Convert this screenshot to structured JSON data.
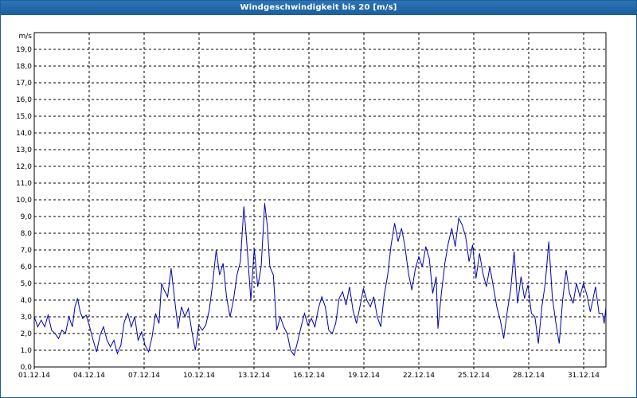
{
  "window": {
    "title": "Windgeschwindigkeit bis 20 [m/s]"
  },
  "chart_data": {
    "type": "line",
    "title": "Windgeschwindigkeit bis 20 [m/s]",
    "ylabel": "m/s",
    "ylim": [
      0,
      20
    ],
    "yticks": [
      "0,0",
      "1,0",
      "2,0",
      "3,0",
      "4,0",
      "5,0",
      "6,0",
      "7,0",
      "8,0",
      "9,0",
      "10,0",
      "11,0",
      "12,0",
      "13,0",
      "14,0",
      "15,0",
      "16,0",
      "17,0",
      "18,0",
      "19,0"
    ],
    "xlim_days": [
      1,
      32.4
    ],
    "xticks": [
      {
        "day": 1,
        "label": "01.12.14"
      },
      {
        "day": 4,
        "label": "04.12.14"
      },
      {
        "day": 7,
        "label": "07.12.14"
      },
      {
        "day": 10,
        "label": "10.12.14"
      },
      {
        "day": 13,
        "label": "13.12.14"
      },
      {
        "day": 16,
        "label": "16.12.14"
      },
      {
        "day": 19,
        "label": "19.12.14"
      },
      {
        "day": 22,
        "label": "22.12.14"
      },
      {
        "day": 25,
        "label": "25.12.14"
      },
      {
        "day": 28,
        "label": "28.12.14"
      },
      {
        "day": 31,
        "label": "31.12.14"
      }
    ],
    "grid": true,
    "line_color": "#0000b0",
    "series": [
      {
        "points": [
          [
            1.0,
            3.0
          ],
          [
            1.2,
            2.4
          ],
          [
            1.4,
            2.8
          ],
          [
            1.6,
            2.4
          ],
          [
            1.8,
            3.1
          ],
          [
            2.0,
            2.2
          ],
          [
            2.2,
            2.0
          ],
          [
            2.4,
            1.7
          ],
          [
            2.6,
            2.2
          ],
          [
            2.8,
            2.0
          ],
          [
            3.0,
            3.0
          ],
          [
            3.2,
            2.4
          ],
          [
            3.35,
            3.6
          ],
          [
            3.5,
            4.1
          ],
          [
            3.65,
            3.3
          ],
          [
            3.8,
            2.9
          ],
          [
            4.0,
            3.1
          ],
          [
            4.2,
            2.4
          ],
          [
            4.4,
            1.6
          ],
          [
            4.6,
            0.9
          ],
          [
            4.8,
            1.9
          ],
          [
            5.0,
            2.4
          ],
          [
            5.2,
            1.6
          ],
          [
            5.4,
            1.2
          ],
          [
            5.6,
            1.6
          ],
          [
            5.8,
            0.8
          ],
          [
            6.0,
            1.3
          ],
          [
            6.2,
            2.7
          ],
          [
            6.4,
            3.2
          ],
          [
            6.6,
            2.4
          ],
          [
            6.8,
            3.0
          ],
          [
            7.0,
            1.6
          ],
          [
            7.2,
            2.1
          ],
          [
            7.4,
            1.3
          ],
          [
            7.6,
            0.9
          ],
          [
            7.8,
            1.8
          ],
          [
            8.0,
            3.2
          ],
          [
            8.2,
            2.6
          ],
          [
            8.35,
            5.0
          ],
          [
            8.5,
            4.6
          ],
          [
            8.7,
            4.2
          ],
          [
            8.9,
            5.9
          ],
          [
            9.1,
            4.1
          ],
          [
            9.3,
            2.3
          ],
          [
            9.5,
            3.6
          ],
          [
            9.7,
            3.0
          ],
          [
            9.9,
            3.5
          ],
          [
            10.1,
            2.1
          ],
          [
            10.3,
            1.0
          ],
          [
            10.5,
            2.5
          ],
          [
            10.7,
            2.2
          ],
          [
            10.9,
            2.5
          ],
          [
            11.1,
            3.4
          ],
          [
            11.3,
            5.0
          ],
          [
            11.5,
            7.0
          ],
          [
            11.7,
            5.5
          ],
          [
            11.9,
            6.2
          ],
          [
            12.1,
            4.2
          ],
          [
            12.3,
            3.0
          ],
          [
            12.5,
            4.0
          ],
          [
            12.7,
            5.5
          ],
          [
            12.9,
            6.3
          ],
          [
            13.1,
            9.6
          ],
          [
            13.3,
            7.0
          ],
          [
            13.5,
            4.0
          ],
          [
            13.7,
            7.1
          ],
          [
            13.9,
            4.8
          ],
          [
            14.1,
            6.0
          ],
          [
            14.3,
            9.8
          ],
          [
            14.45,
            8.5
          ],
          [
            14.6,
            6.0
          ],
          [
            14.8,
            5.5
          ],
          [
            15.0,
            2.2
          ],
          [
            15.2,
            3.0
          ],
          [
            15.4,
            2.4
          ],
          [
            15.6,
            2.0
          ],
          [
            15.8,
            1.0
          ],
          [
            16.0,
            0.7
          ],
          [
            16.2,
            1.5
          ],
          [
            16.4,
            2.4
          ],
          [
            16.6,
            3.2
          ],
          [
            16.8,
            2.5
          ],
          [
            17.0,
            2.9
          ],
          [
            17.2,
            2.4
          ],
          [
            17.4,
            3.5
          ],
          [
            17.6,
            4.2
          ],
          [
            17.8,
            3.6
          ],
          [
            18.0,
            2.2
          ],
          [
            18.2,
            2.0
          ],
          [
            18.4,
            2.6
          ],
          [
            18.6,
            4.1
          ],
          [
            18.8,
            4.5
          ],
          [
            19.0,
            3.7
          ],
          [
            19.2,
            4.8
          ],
          [
            19.4,
            3.4
          ],
          [
            19.6,
            2.6
          ],
          [
            19.8,
            3.6
          ],
          [
            20.0,
            4.7
          ],
          [
            20.2,
            4.0
          ],
          [
            20.4,
            3.6
          ],
          [
            20.6,
            4.2
          ],
          [
            20.8,
            3.0
          ],
          [
            21.0,
            2.4
          ],
          [
            21.2,
            4.3
          ],
          [
            21.4,
            5.5
          ],
          [
            21.6,
            7.3
          ],
          [
            21.8,
            8.6
          ],
          [
            22.0,
            7.5
          ],
          [
            22.2,
            8.3
          ],
          [
            22.4,
            7.2
          ],
          [
            22.6,
            5.6
          ],
          [
            22.8,
            4.6
          ],
          [
            23.0,
            5.9
          ],
          [
            23.2,
            6.6
          ],
          [
            23.4,
            6.0
          ],
          [
            23.6,
            7.2
          ],
          [
            23.8,
            6.5
          ],
          [
            24.0,
            4.4
          ],
          [
            24.2,
            5.4
          ],
          [
            24.3,
            2.3
          ],
          [
            24.5,
            4.4
          ],
          [
            24.7,
            6.2
          ],
          [
            24.9,
            7.4
          ],
          [
            25.1,
            8.3
          ],
          [
            25.3,
            7.2
          ],
          [
            25.5,
            8.9
          ],
          [
            25.7,
            8.5
          ],
          [
            25.9,
            7.8
          ],
          [
            26.1,
            6.3
          ],
          [
            26.3,
            7.3
          ],
          [
            26.5,
            5.3
          ],
          [
            26.7,
            6.8
          ],
          [
            26.9,
            5.6
          ],
          [
            27.1,
            4.8
          ],
          [
            27.3,
            6.0
          ],
          [
            27.5,
            4.8
          ],
          [
            27.7,
            3.6
          ],
          [
            27.9,
            2.8
          ],
          [
            28.1,
            1.7
          ],
          [
            28.3,
            3.3
          ],
          [
            28.5,
            4.6
          ],
          [
            28.7,
            6.9
          ],
          [
            28.9,
            3.8
          ],
          [
            29.1,
            5.4
          ],
          [
            29.3,
            4.1
          ],
          [
            29.5,
            4.9
          ],
          [
            29.7,
            3.2
          ],
          [
            29.9,
            3.0
          ],
          [
            30.1,
            1.4
          ],
          [
            30.3,
            3.6
          ],
          [
            30.5,
            5.0
          ],
          [
            30.7,
            7.5
          ],
          [
            30.9,
            4.2
          ],
          [
            31.1,
            2.7
          ],
          [
            31.3,
            1.4
          ],
          [
            31.5,
            4.0
          ],
          [
            31.7,
            5.8
          ],
          [
            31.9,
            4.4
          ],
          [
            32.1,
            3.8
          ],
          [
            32.3,
            5.0
          ],
          [
            32.5,
            4.2
          ],
          [
            32.7,
            5.0
          ],
          [
            32.9,
            4.3
          ],
          [
            33.1,
            3.3
          ],
          [
            33.2,
            3.8
          ],
          [
            33.4,
            4.8
          ],
          [
            33.6,
            3.2
          ],
          [
            33.8,
            3.2
          ],
          [
            33.9,
            2.6
          ],
          [
            34.0,
            3.6
          ]
        ]
      }
    ]
  }
}
